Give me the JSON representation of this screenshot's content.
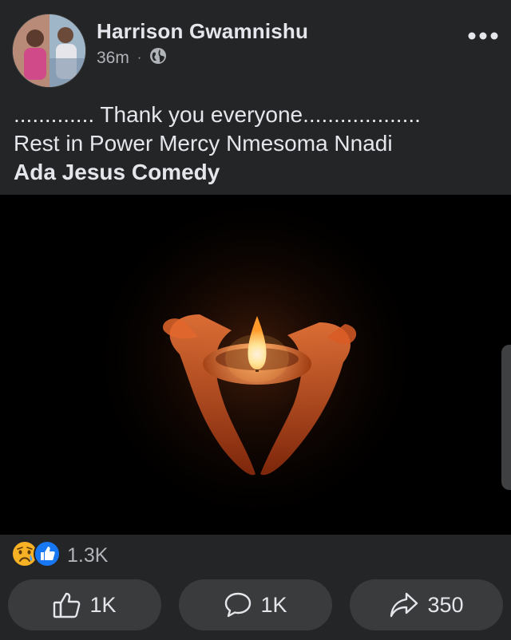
{
  "post": {
    "author": "Harrison Gwamnishu",
    "time": "36m",
    "separator": "·",
    "privacy_icon": "globe-icon",
    "more_icon": "more-horizontal-icon",
    "text_lines": [
      "............. Thank you everyone...................",
      "Rest in Power Mercy Nmesoma Nnadi"
    ],
    "tagged_page": "Ada Jesus Comedy"
  },
  "reactions": {
    "icons": [
      "sad-reaction-icon",
      "like-reaction-icon"
    ],
    "count": "1.3K"
  },
  "actions": {
    "like": {
      "icon": "thumbs-up-icon",
      "label": "1K"
    },
    "comment": {
      "icon": "comment-bubble-icon",
      "label": "1K"
    },
    "share": {
      "icon": "share-arrow-icon",
      "label": "350"
    }
  },
  "colors": {
    "background": "#242526",
    "button": "#3a3b3c",
    "text_primary": "#e4e6eb",
    "text_secondary": "#b0b3b8",
    "like_blue": "#1877f2",
    "sad_yellow": "#f7b125"
  }
}
